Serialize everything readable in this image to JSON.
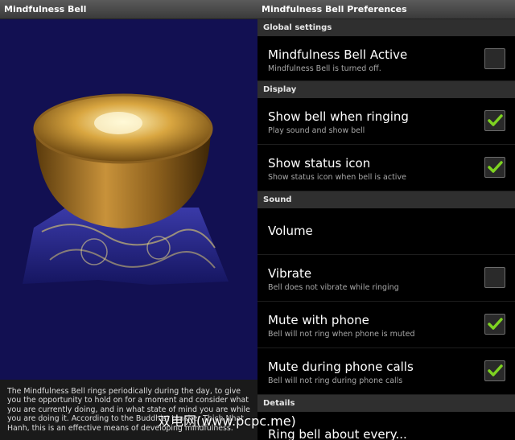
{
  "left": {
    "title": "Mindfulness Bell",
    "description": "The Mindfulness Bell rings periodically during the day, to give you the opportunity to hold on for a moment and consider what you are currently doing, and in what state of mind you are while you are doing it. According to the Buddhist teacher Thich Nhat Hanh, this is an effective means of developing mindfulness."
  },
  "right": {
    "title": "Mindfulness Bell Preferences",
    "sections": {
      "global": "Global settings",
      "display": "Display",
      "sound": "Sound",
      "details": "Details"
    },
    "prefs": {
      "active": {
        "title": "Mindfulness Bell Active",
        "summary": "Mindfulness Bell is turned off.",
        "checked": false
      },
      "show_bell": {
        "title": "Show bell when ringing",
        "summary": "Play sound and show bell",
        "checked": true
      },
      "status_icon": {
        "title": "Show status icon",
        "summary": "Show status icon when bell is active",
        "checked": true
      },
      "volume": {
        "title": "Volume"
      },
      "vibrate": {
        "title": "Vibrate",
        "summary": "Bell does not vibrate while ringing",
        "checked": false
      },
      "mute_phone": {
        "title": "Mute with phone",
        "summary": "Bell will not ring when phone is muted",
        "checked": true
      },
      "mute_calls": {
        "title": "Mute during phone calls",
        "summary": "Bell will not ring during phone calls",
        "checked": true
      },
      "ring_every": {
        "title": "Ring bell about every..."
      }
    }
  },
  "watermark": "双电网(www.pcpc.me)",
  "colors": {
    "check": "#7ed321",
    "category_bg": "#2f2f2f",
    "left_bg": "#121052"
  }
}
